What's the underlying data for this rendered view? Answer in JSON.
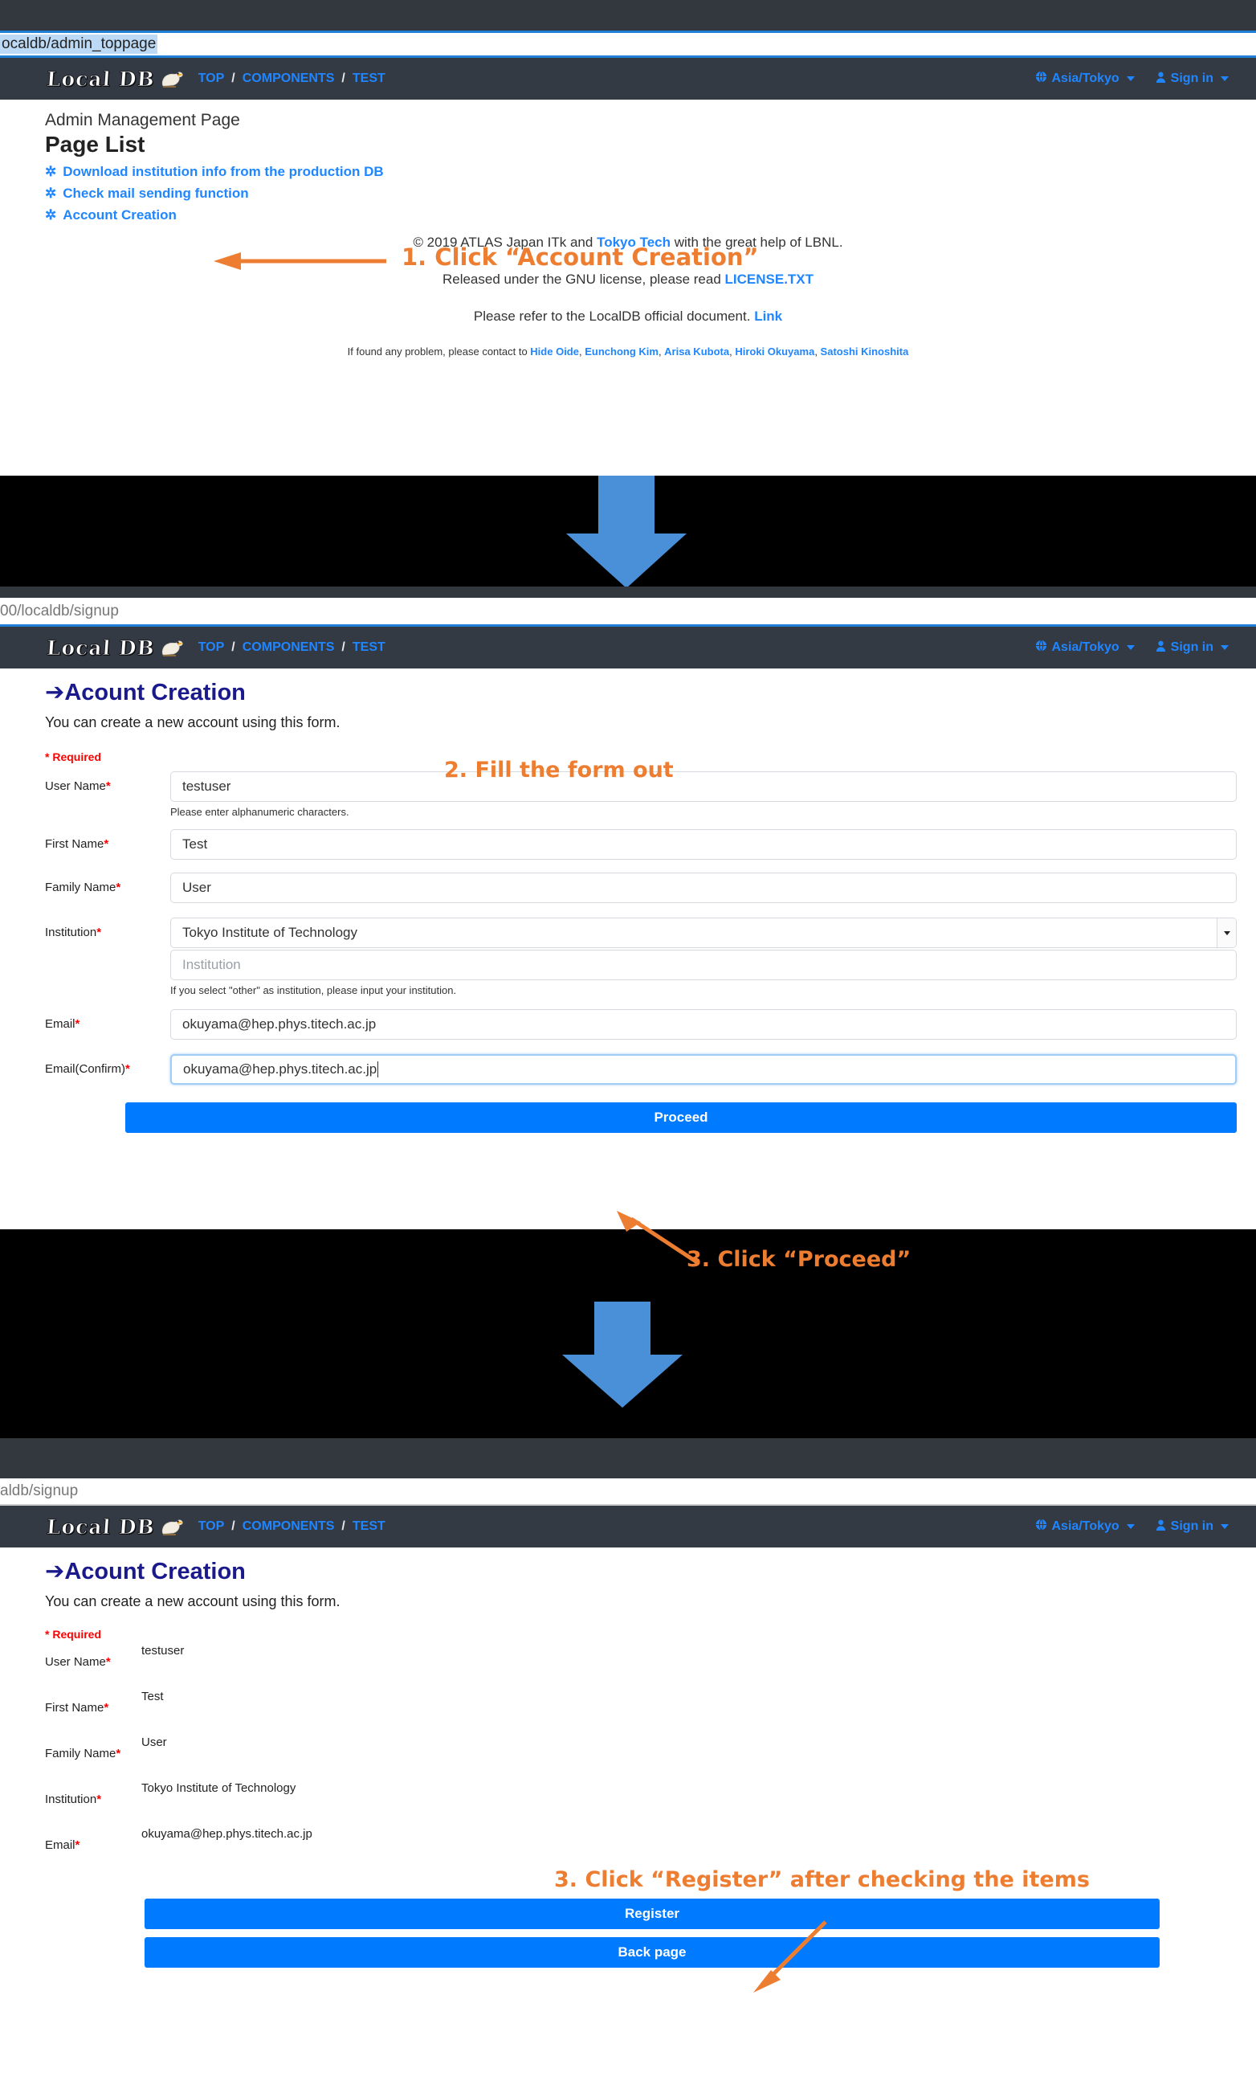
{
  "panels": [
    {
      "url": "ocaldb/admin_toppage",
      "navbar": {
        "brand": "Local DB",
        "links": [
          "TOP",
          "COMPONENTS",
          "TEST"
        ],
        "separator": "/",
        "timezone": "Asia/Tokyo",
        "signin": "Sign in",
        "globe_icon": "globe-icon",
        "user_icon": "user-icon"
      },
      "subtitle": "Admin Management Page",
      "title": "Page List",
      "items": [
        "Download institution info from the production DB",
        "Check mail sending function",
        "Account Creation"
      ],
      "footer": {
        "line1_a": "© 2019 ATLAS Japan ITk and ",
        "line1_link": "Tokyo Tech",
        "line1_b": " with the great help of LBNL.",
        "line2_a": "Released under the GNU license, please read ",
        "line2_link": "LICENSE.TXT",
        "line3_a": "Please refer to the LocalDB official document. ",
        "line3_link": "Link",
        "line4_a": "If found any problem, please contact to ",
        "contacts": [
          "Hide Oide",
          "Eunchong Kim",
          "Arisa Kubota",
          "Hiroki Okuyama",
          "Satoshi Kinoshita"
        ]
      },
      "annotation": "1. Click “Account Creation”"
    },
    {
      "url": "00/localdb/signup",
      "heading": "Acount Creation",
      "heading_arrow": "➔",
      "description": "You can create a new account using this form.",
      "required_note": "* Required",
      "annotation": "2. Fill the form out",
      "annotation2": "3. Click “Proceed”",
      "fields": [
        {
          "label": "User Name",
          "required": true,
          "value": "testuser",
          "hint": "Please enter alphanumeric characters."
        },
        {
          "label": "First Name",
          "required": true,
          "value": "Test",
          "hint": ""
        },
        {
          "label": "Family Name",
          "required": true,
          "value": "User",
          "hint": ""
        },
        {
          "label": "Institution",
          "required": true,
          "value": "Tokyo Institute of Technology",
          "placeholder": "Institution",
          "hint": "If you select \"other\" as institution, please input your institution."
        },
        {
          "label": "Email",
          "required": true,
          "value": "okuyama@hep.phys.titech.ac.jp",
          "hint": ""
        },
        {
          "label": "Email(Confirm)",
          "required": true,
          "value": "okuyama@hep.phys.titech.ac.jp",
          "hint": "",
          "focused": true
        }
      ],
      "submit_label": "Proceed"
    },
    {
      "url": "aldb/signup",
      "heading": "Acount Creation",
      "heading_arrow": "➔",
      "description": "You can create a new account using this form.",
      "required_note": "* Required",
      "annotation": "3. Click “Register” after checking the items",
      "rows": [
        {
          "label": "User Name",
          "required": true,
          "value": "testuser"
        },
        {
          "label": "First Name",
          "required": true,
          "value": "Test"
        },
        {
          "label": "Family Name",
          "required": true,
          "value": "User"
        },
        {
          "label": "Institution",
          "required": true,
          "value": "Tokyo Institute of Technology"
        },
        {
          "label": "Email",
          "required": true,
          "value": "okuyama@hep.phys.titech.ac.jp"
        }
      ],
      "register_label": "Register",
      "back_label": "Back page"
    }
  ],
  "colors": {
    "accent_orange": "#ED7D31",
    "link_blue": "#1f86ff",
    "navbar_dark": "#343a44",
    "button_blue": "#007bff",
    "required_red": "#ff0000",
    "heading_navy": "#1a1a8c"
  }
}
